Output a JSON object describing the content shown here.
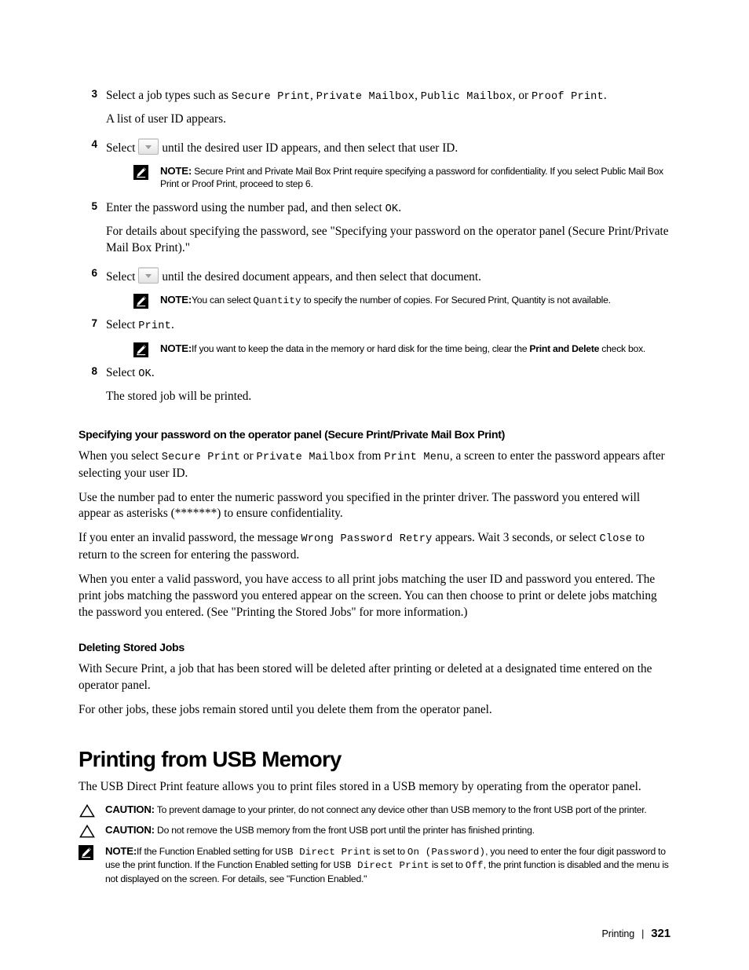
{
  "document": {
    "footer": {
      "section": "Printing",
      "separator": "|",
      "page_number": "321"
    }
  },
  "steps": [
    {
      "number": "3",
      "line_prefix": "Select a job types such as ",
      "terms": [
        "Secure Print",
        "Private Mailbox",
        "Public Mailbox",
        "Proof Print"
      ],
      "sep1": ", ",
      "sep2": ", ",
      "sep3": ", or ",
      "line_suffix": ".",
      "sub": "A list of user ID appears."
    },
    {
      "number": "4",
      "pre": "Select",
      "post": "until the desired user ID appears, and then select that user ID."
    },
    {
      "number": "5",
      "pre": "Enter the password using the number pad, and then select ",
      "term": "OK",
      "post": ".",
      "sub": "For details about specifying the password, see \"Specifying your password on the operator panel (Secure Print/Private Mail Box Print).\""
    },
    {
      "number": "6",
      "pre": "Select",
      "post": "until the desired document appears, and then select that document."
    },
    {
      "number": "7",
      "pre": "Select ",
      "term": "Print",
      "post": "."
    },
    {
      "number": "8",
      "pre": "Select ",
      "term": "OK",
      "post": ".",
      "sub": "The stored job will be printed."
    }
  ],
  "callouts": {
    "note_label": "NOTE:",
    "caution_label": "CAUTION:",
    "note_step4": "Secure Print and Private Mail Box Print require specifying a password for confidentiality. If you select Public Mail Box Print or Proof Print, proceed to step 6.",
    "note_step6_a": "You can select ",
    "note_step6_term": "Quantity",
    "note_step6_b": " to specify the number of copies. For Secured Print, Quantity is not available.",
    "note_step7_a": "If you want to keep the data in the memory or hard disk for the time being, clear the ",
    "note_step7_bold": "Print and Delete",
    "note_step7_b": " check box.",
    "caution_usb_1": "To prevent damage to your printer, do not connect any device other than USB memory to the front USB port of the printer.",
    "caution_usb_2": "Do not remove the USB memory from the front USB port until the printer has finished printing.",
    "note_usb_a": "If the Function Enabled setting for ",
    "note_usb_term1": "USB Direct Print",
    "note_usb_b": " is set to ",
    "note_usb_term2": "On (Password)",
    "note_usb_c": ", you need to enter the four digit password to use the print function. If the Function Enabled setting for ",
    "note_usb_term3": "USB Direct Print",
    "note_usb_d": " is set to ",
    "note_usb_term4": "Off",
    "note_usb_e": ", the print function is disabled and the menu is not displayed on the screen. For details, see \"Function Enabled.\""
  },
  "sections": {
    "specifying_password": {
      "heading": "Specifying your password on the operator panel (Secure Print/Private Mail Box Print)",
      "p1_a": "When you select ",
      "p1_term1": "Secure Print",
      "p1_b": " or ",
      "p1_term2": "Private Mailbox",
      "p1_c": " from ",
      "p1_term3": "Print Menu",
      "p1_d": ", a screen to enter the password appears after selecting your user ID.",
      "p2": "Use the number pad to enter the numeric password you specified in the printer driver. The password you entered will appear as asterisks (*******) to ensure confidentiality.",
      "p3_a": "If you enter an invalid password, the message ",
      "p3_term1": "Wrong Password Retry",
      "p3_b": " appears. Wait 3 seconds, or select ",
      "p3_term2": "Close",
      "p3_c": " to return to the screen for entering the password.",
      "p4": "When you enter a valid password, you have access to all print jobs matching the user ID and password you entered. The print jobs matching the password you entered appear on the screen. You can then choose to print or delete jobs matching the password you entered. (See \"Printing the Stored Jobs\" for more information.)"
    },
    "deleting_stored_jobs": {
      "heading": "Deleting Stored Jobs",
      "p1": "With Secure Print, a job that has been stored will be deleted after printing or deleted at a designated time entered on the operator panel.",
      "p2": "For other jobs, these jobs remain stored until you delete them from the operator panel."
    },
    "printing_from_usb": {
      "heading": "Printing from USB Memory",
      "p1": "The USB Direct Print feature allows you to print files stored in a USB memory by operating from the operator panel."
    }
  }
}
